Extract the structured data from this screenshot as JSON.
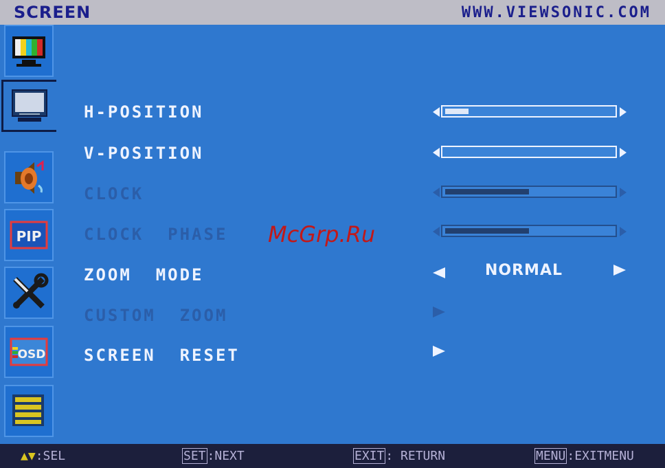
{
  "header": {
    "title": "SCREEN",
    "website": "WWW.VIEWSONIC.COM"
  },
  "sidebar": {
    "items": [
      {
        "name": "color-icon",
        "label": ""
      },
      {
        "name": "screen-icon",
        "label": "",
        "active": true
      },
      {
        "name": "audio-icon",
        "label": ""
      },
      {
        "name": "pip-icon",
        "label": "PIP"
      },
      {
        "name": "setup-tools-icon",
        "label": ""
      },
      {
        "name": "osd-icon",
        "label": "OSD"
      },
      {
        "name": "menu-list-icon",
        "label": ""
      }
    ]
  },
  "menu": {
    "rows": [
      {
        "label": "H-POSITION",
        "enabled": true,
        "level": 0.14
      },
      {
        "label": "V-POSITION",
        "enabled": true,
        "level": 0.0
      },
      {
        "label": "CLOCK",
        "enabled": false,
        "level": 0.5
      },
      {
        "label": "CLOCK  PHASE",
        "enabled": false,
        "level": 0.5
      },
      {
        "label": "ZOOM  MODE",
        "enabled": true,
        "value": "NORMAL"
      },
      {
        "label": "CUSTOM  ZOOM",
        "enabled": false
      },
      {
        "label": "SCREEN  RESET",
        "enabled": true
      }
    ]
  },
  "footer": {
    "sel_keys": "▲▼",
    "sel_label": ":SEL",
    "set_key": "SET",
    "set_label": ":NEXT",
    "exit_key": "EXIT",
    "exit_label": ": RETURN",
    "menu_key": "MENU",
    "menu_label": ":EXITMENU"
  },
  "watermark": "McGrp.Ru",
  "colors": {
    "panel": "#2f78cf",
    "text_enabled": "#eef3ff",
    "text_disabled": "#2b5ea9",
    "header_text": "#1b1f8c",
    "footer_bg": "#1c1f3c"
  }
}
